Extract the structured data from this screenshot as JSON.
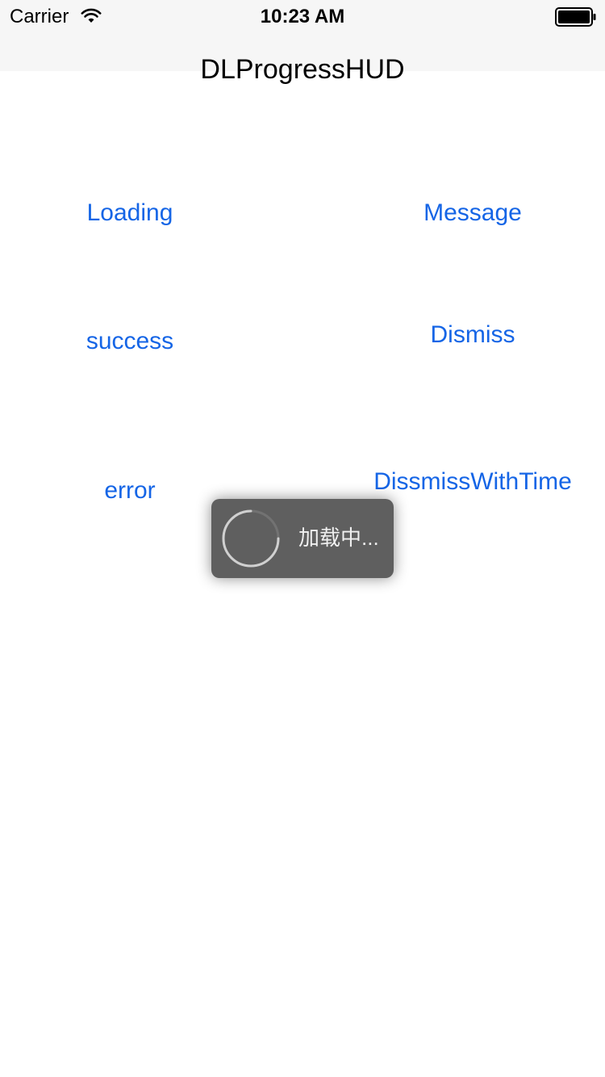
{
  "status_bar": {
    "carrier": "Carrier",
    "time": "10:23 AM",
    "wifi_icon": "wifi-icon",
    "battery_icon": "battery-full-icon"
  },
  "nav": {
    "title": "DLProgressHUD"
  },
  "buttons": {
    "loading": "Loading",
    "message": "Message",
    "success": "success",
    "dismiss": "Dismiss",
    "error": "error",
    "dismiss_with_time": "DissmissWithTime"
  },
  "hud": {
    "text": "加载中...",
    "spinner_icon": "loading-spinner-icon"
  },
  "colors": {
    "accent": "#1565e6",
    "status_bar_bg": "#f6f6f6",
    "hud_bg": "#3c3c3c"
  }
}
